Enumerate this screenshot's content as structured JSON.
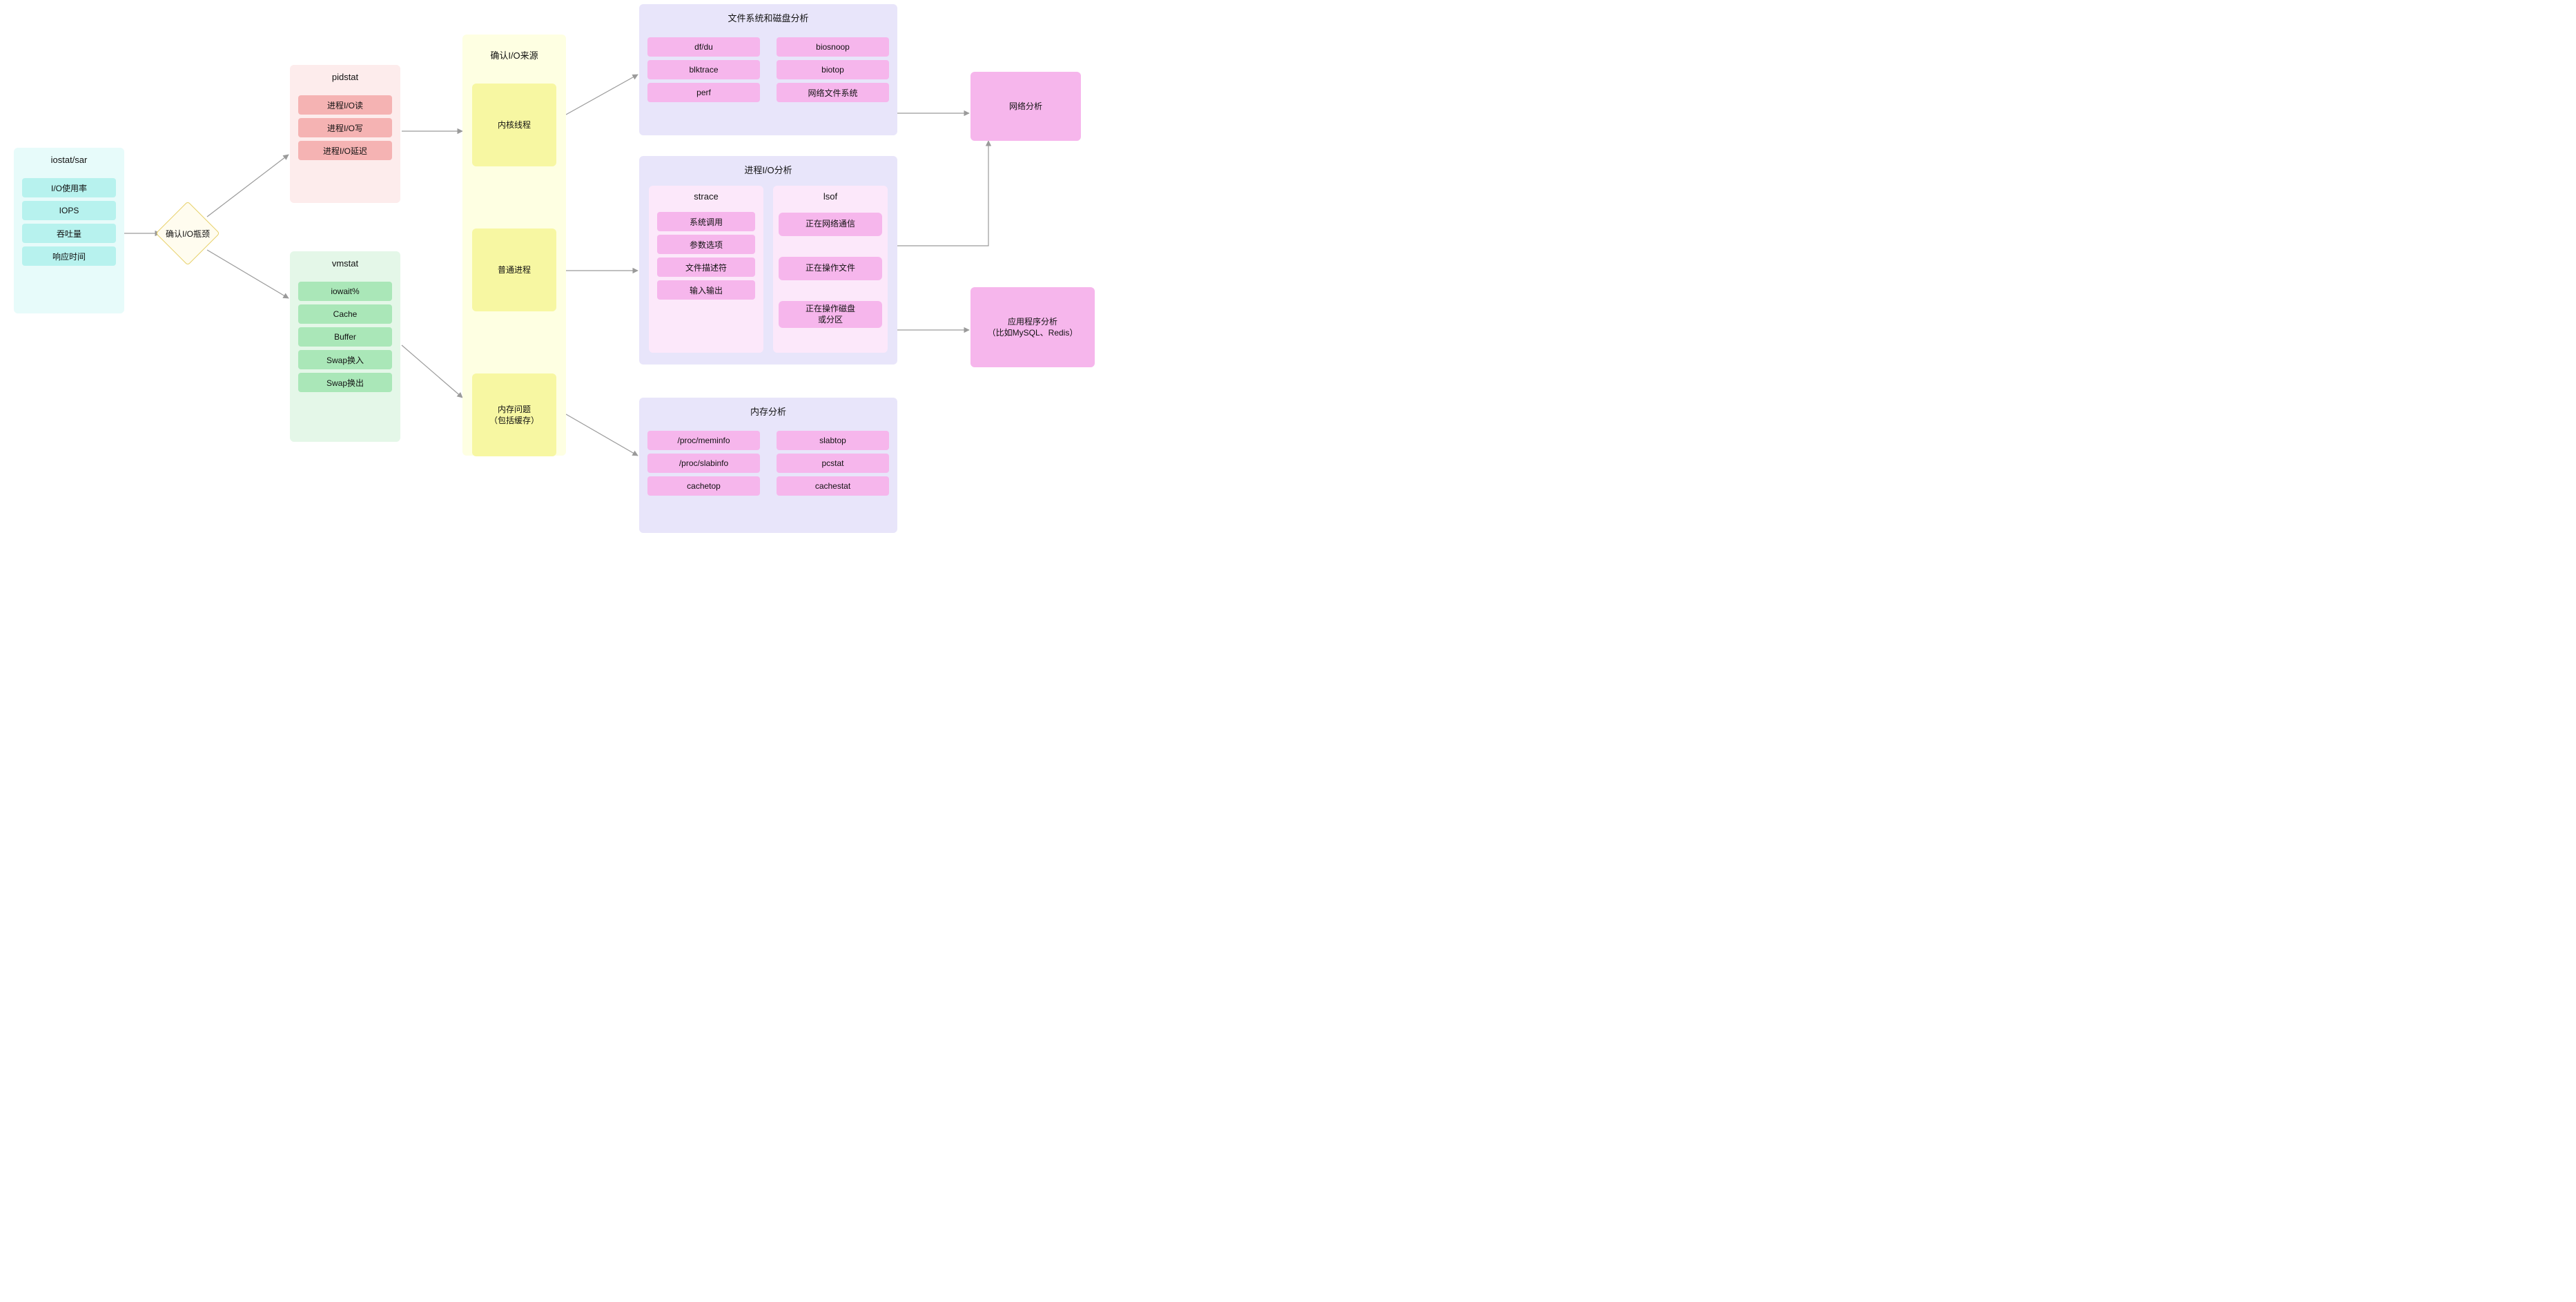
{
  "iostat": {
    "title": "iostat/sar",
    "items": [
      "I/O使用率",
      "IOPS",
      "吞吐量",
      "响应时间"
    ]
  },
  "decision": {
    "label": "确认I/O瓶颈"
  },
  "pidstat": {
    "title": "pidstat",
    "items": [
      "进程I/O读",
      "进程I/O写",
      "进程I/O延迟"
    ]
  },
  "vmstat": {
    "title": "vmstat",
    "items": [
      "iowait%",
      "Cache",
      "Buffer",
      "Swap换入",
      "Swap换出"
    ]
  },
  "source": {
    "title": "确认I/O来源",
    "items": [
      "内核线程",
      "普通进程",
      "内存问题\n（包括缓存）"
    ]
  },
  "fsdisk": {
    "title": "文件系统和磁盘分析",
    "left": [
      "df/du",
      "blktrace",
      "perf"
    ],
    "right": [
      "biosnoop",
      "biotop",
      "网络文件系统"
    ]
  },
  "procio": {
    "title": "进程I/O分析",
    "strace": {
      "title": "strace",
      "items": [
        "系统调用",
        "参数选项",
        "文件描述符",
        "输入输出"
      ]
    },
    "lsof": {
      "title": "lsof",
      "items": [
        "正在网络通信",
        "正在操作文件",
        "正在操作磁盘\n或分区"
      ]
    }
  },
  "mem": {
    "title": "内存分析",
    "left": [
      "/proc/meminfo",
      "/proc/slabinfo",
      "cachetop"
    ],
    "right": [
      "slabtop",
      "pcstat",
      "cachestat"
    ]
  },
  "net": {
    "label": "网络分析"
  },
  "app": {
    "label": "应用程序分析\n（比如MySQL、Redis）"
  }
}
